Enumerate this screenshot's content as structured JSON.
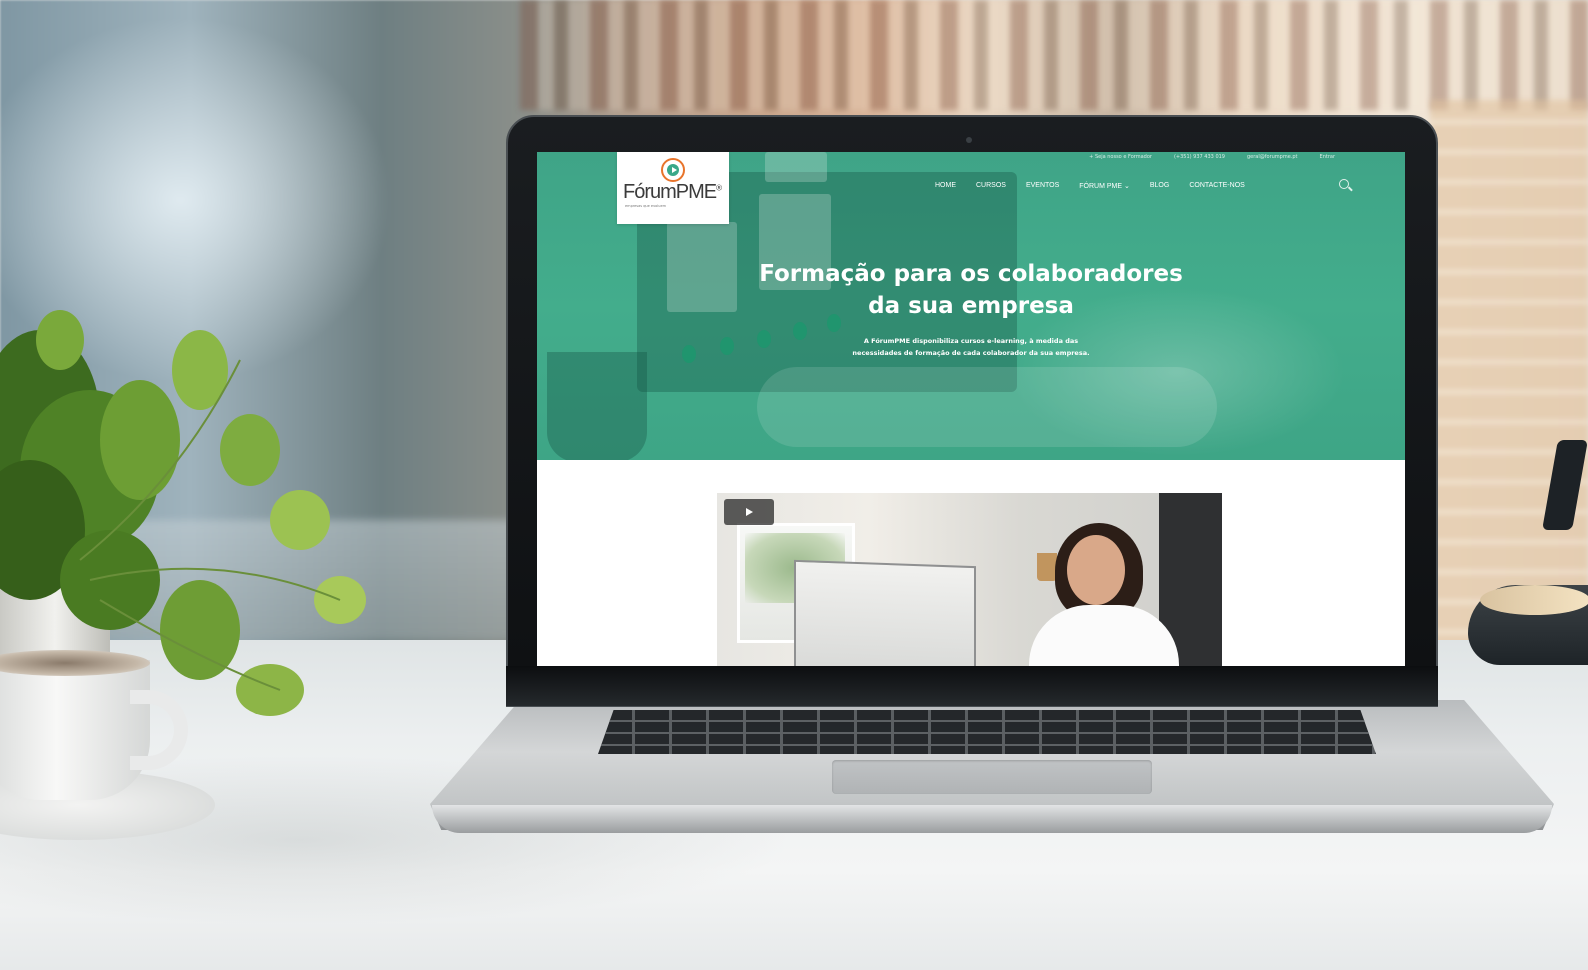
{
  "site": {
    "topbar": {
      "formador_link": "+ Seja nosso e Formador",
      "phone": "(+351) 937 433 019",
      "email": "geral@forumpme.pt",
      "login": "Entrar"
    },
    "logo": {
      "name": "FórumPME",
      "registered": "®",
      "tagline": "empresas que evoluem"
    },
    "nav": {
      "items": [
        "HOME",
        "CURSOS",
        "EVENTOS",
        "FÓRUM PME ⌄",
        "BLOG",
        "CONTACTE-NOS"
      ],
      "search_icon": "search-icon"
    },
    "hero": {
      "title_line1": "Formação para os colaboradores",
      "title_line2": "da sua empresa",
      "desc_line1": "A FórumPME disponibiliza cursos e-learning, à medida das",
      "desc_line2": "necessidades de formação de cada colaborador da sua empresa."
    },
    "video": {
      "play_icon": "play-icon"
    }
  },
  "colors": {
    "brand_green": "#41a98a",
    "brand_orange": "#e8742b"
  }
}
